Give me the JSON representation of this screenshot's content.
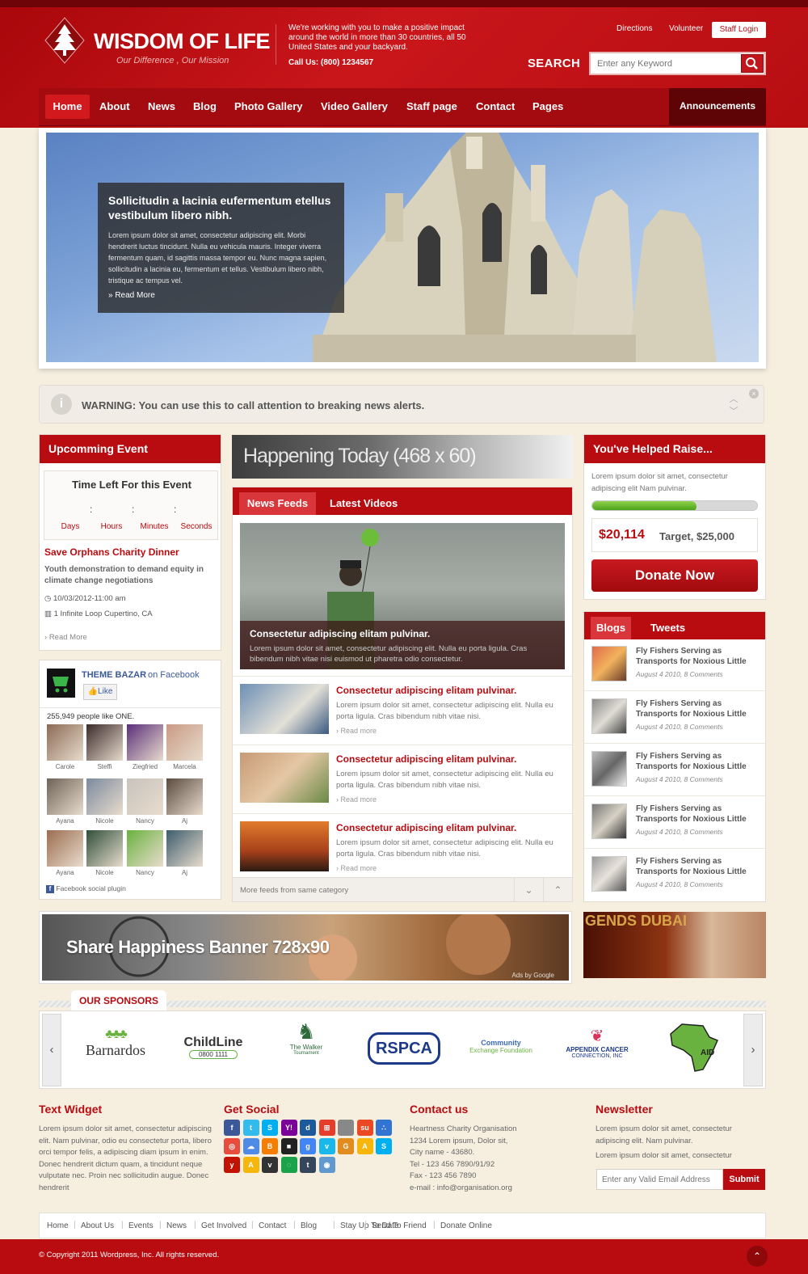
{
  "header": {
    "site_title": "WISDOM OF LIFE",
    "tagline": "Our Difference , Our Mission",
    "intro": "We're working with you to make a positive impact around the world in more than 30 countries, all 50 United States and your backyard.",
    "phone": "Call Us: (800) 1234567",
    "top_links": [
      "Directions",
      "Volunteer"
    ],
    "staff_login": "Staff Login",
    "search_label": "SEARCH",
    "search_placeholder": "Enter any Keyword"
  },
  "nav": {
    "items": [
      "Home",
      "About",
      "News",
      "Blog",
      "Photo Gallery",
      "Video Gallery",
      "Staff page",
      "Contact",
      "Pages"
    ],
    "announcements": "Announcements"
  },
  "slider": {
    "title": "Sollicitudin a lacinia eufermentum etellus vestibulum libero nibh.",
    "text": "Lorem ipsum dolor sit amet, consectetur adipiscing elit. Morbi hendrerit luctus tincidunt. Nulla eu vehicula mauris. Integer viverra fermentum quam, id sagittis massa tempor eu. Nunc magna sapien, sollicitudin a lacinia eu, fermentum et tellus. Vestibulum libero nibh, tristique ac tempus vel.",
    "read_more": "» Read More"
  },
  "warning": {
    "icon": "i",
    "text": "WARNING: You can use this to call attention to breaking news alerts."
  },
  "event": {
    "heading": "Upcomming Event",
    "countdown_title": "Time Left For this Event",
    "units": [
      "Days",
      "Hours",
      "Minutes",
      "Seconds"
    ],
    "title": "Save Orphans Charity Dinner",
    "desc": "Youth demonstration to demand equity in climate change negotiations",
    "date": "10/03/2012-11:00 am",
    "location": "1 Infinite Loop Cupertino, CA",
    "read_more": "Read More"
  },
  "facebook": {
    "page_name": "THEME BAZAR",
    "on_facebook": "on Facebook",
    "like": "Like",
    "count_text": "255,949 people like ONE.",
    "people": [
      "Carole",
      "Steffi",
      "Ziegfried",
      "Marcela",
      "Ayana",
      "Nicole",
      "Nancy",
      "Aj",
      "Ayana",
      "Nicole",
      "Nancy",
      "Aj"
    ],
    "plugin": "Facebook social plugin"
  },
  "happening": {
    "text": "Happening Today (468 x 60)"
  },
  "news": {
    "tabs": [
      "News Feeds",
      "Latest Videos"
    ],
    "featured_title": "Consectetur adipiscing elitam pulvinar.",
    "featured_text": "Lorem ipsum dolor sit amet, consectetur adipiscing elit. Nulla eu porta ligula. Cras bibendum nibh vitae nisi euismod ut pharetra odio consectetur.",
    "items": [
      {
        "title": "Consectetur adipiscing elitam pulvinar.",
        "text": "Lorem ipsum dolor sit amet, consectetur adipiscing elit. Nulla eu porta ligula. Cras bibendum nibh vitae nisi.",
        "more": "Read more"
      },
      {
        "title": "Consectetur adipiscing elitam pulvinar.",
        "text": "Lorem ipsum dolor sit amet, consectetur adipiscing elit. Nulla eu porta ligula. Cras bibendum nibh vitae nisi.",
        "more": "Read more"
      },
      {
        "title": "Consectetur adipiscing elitam pulvinar.",
        "text": "Lorem ipsum dolor sit amet, consectetur adipiscing elit. Nulla eu porta ligula. Cras bibendum nibh vitae nisi.",
        "more": "Read more"
      }
    ],
    "footer": "More feeds from same category"
  },
  "raise": {
    "heading": "You've Helped Raise...",
    "text": "Lorem ipsum dolor sit amet, consectetur adipiscing elit Nam pulvinar.",
    "progress": 0.63,
    "amount": "$20,114",
    "target": "Target, $25,000",
    "donate": "Donate Now"
  },
  "blogs": {
    "tabs": [
      "Blogs",
      "Tweets"
    ],
    "items": [
      {
        "title": "Fly Fishers Serving as Transports for Noxious Little",
        "meta": "August 4 2010, 8 Comments"
      },
      {
        "title": "Fly Fishers Serving as Transports for Noxious Little",
        "meta": "August 4 2010, 8 Comments"
      },
      {
        "title": "Fly Fishers Serving as Transports for Noxious Little",
        "meta": "August 4 2010, 8 Comments"
      },
      {
        "title": "Fly Fishers Serving as Transports for Noxious Little",
        "meta": "August 4 2010, 8 Comments"
      },
      {
        "title": "Fly Fishers Serving as Transports for Noxious Little",
        "meta": "August 4 2010, 8 Comments"
      }
    ]
  },
  "banners": {
    "big": "Share Happiness Banner 728x90",
    "big_credit": "Ads by Google",
    "small": "GENDS DUBAI"
  },
  "sponsors": {
    "heading": "OUR SPONSORS",
    "items": [
      {
        "name": "Barnardos"
      },
      {
        "name": "ChildLine",
        "sub": "0800 1111"
      },
      {
        "name": "The Walker",
        "sub": "Tournament"
      },
      {
        "name": "RSPCA"
      },
      {
        "name": "Community",
        "sub": "Exchange Foundation"
      },
      {
        "name": "APPENDIX CANCER",
        "sub": "CONNECTION, INC"
      },
      {
        "name": "AID"
      }
    ]
  },
  "footer": {
    "text_widget_title": "Text Widget",
    "text_widget": "Lorem ipsum dolor sit amet, consectetur adipiscing elit. Nam pulvinar, odio eu consectetur porta, libero orci tempor felis, a adipiscing diam ipsum in enim. Donec hendrerit dictum quam, a tincidunt neque vulputate nec. Proin nec sollicitudin augue. Donec hendrerit",
    "social_title": "Get Social",
    "social_icons": [
      "facebook-icon",
      "twitter-icon",
      "skype-icon",
      "yahoo-icon",
      "digg-icon",
      "windows-icon",
      "apple-icon",
      "stumbleupon-icon",
      "delicious-icon",
      "picasa-icon",
      "cloud-icon",
      "blogger-icon",
      "delicious-icon",
      "google-icon",
      "vimeo-icon",
      "gowalla-icon",
      "aim-icon",
      "skype-icon",
      "yelp-icon",
      "aim-icon",
      "viddler-icon",
      "ichat-icon",
      "tumblr-icon",
      "reddit-icon"
    ],
    "contact_title": "Contact us",
    "contact_lines": [
      "Heartness Charity Organisation",
      "1234 Lorem ipsum, Dolor sit,",
      "City name - 43680.",
      "Tel - 123 456 7890/91/92",
      "Fax - 123 456 7890",
      "e-mail : info@organisation.org"
    ],
    "newsletter_title": "Newsletter",
    "newsletter_text1": "Lorem ipsum dolor sit amet, consectetur adipiscing elit. Nam pulvinar.",
    "newsletter_text2": "Lorem ipsum dolor sit amet, consectetur",
    "email_placeholder": "Enter any Valid Email Address",
    "submit": "Submit",
    "links": [
      "Home",
      "About Us",
      "Events",
      "News",
      "Get Involved",
      "Contact",
      "Blog",
      "Stay Up To Date",
      "Send To Friend",
      "Donate Online"
    ],
    "copyright": "© Copyright 2011 Wordpress, Inc. All rights reserved."
  },
  "colors": {
    "brand_red": "#b80c11",
    "dark_red": "#6e0407",
    "progress_green": "#5cb82a"
  }
}
